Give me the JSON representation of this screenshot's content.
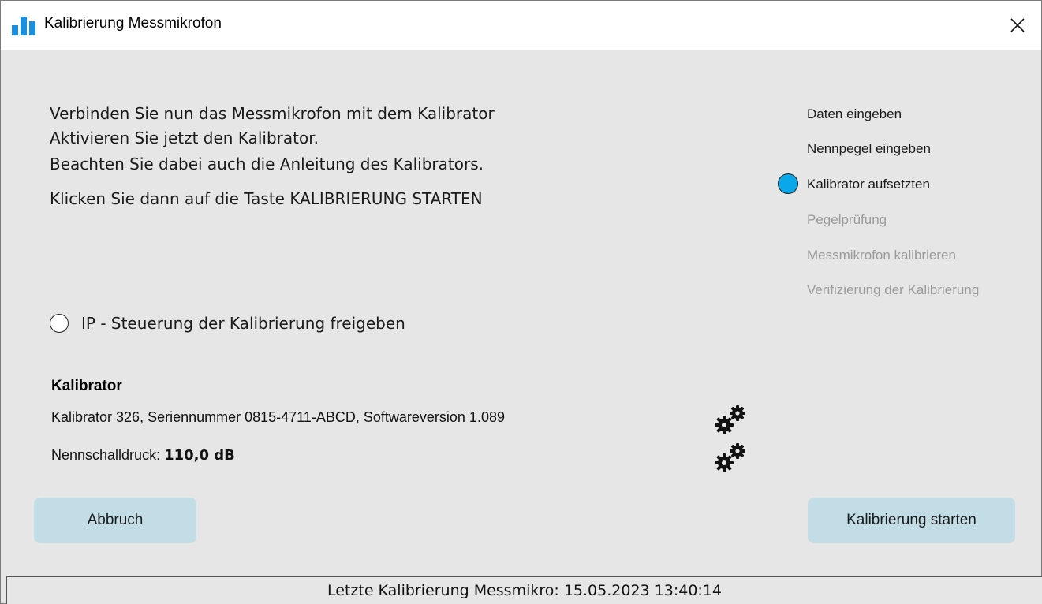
{
  "window": {
    "title": "Kalibrierung Messmikrofon",
    "close_glyph": "✕",
    "accent_color": "#0aa8e8"
  },
  "instructions": {
    "line1": "Verbinden Sie nun das Messmikrofon mit dem Kalibrator",
    "line2": "Aktivieren Sie jetzt den Kalibrator.",
    "line3": "Beachten Sie dabei auch die Anleitung des Kalibrators.",
    "line4": "Klicken Sie dann auf die Taste KALIBRIERUNG STARTEN"
  },
  "steps": [
    {
      "label": "Daten eingeben",
      "state": "done"
    },
    {
      "label": "Nennpegel eingeben",
      "state": "done"
    },
    {
      "label": "Kalibrator aufsetzten",
      "state": "current"
    },
    {
      "label": "Pegelprüfung",
      "state": "pending"
    },
    {
      "label": "Messmikrofon kalibrieren",
      "state": "pending"
    },
    {
      "label": "Verifizierung der Kalibrierung",
      "state": "pending"
    }
  ],
  "ip_control": {
    "label": "IP - Steuerung der Kalibrierung freigeben",
    "checked": false
  },
  "calibrator": {
    "heading": "Kalibrator",
    "details": "Kalibrator 326, Seriennummer 0815-4711-ABCD, Softwareversion 1.089",
    "pressure_label": "Nennschalldruck:",
    "pressure_value": "110,0 dB"
  },
  "buttons": {
    "cancel": "Abbruch",
    "start": "Kalibrierung starten"
  },
  "status": {
    "text": "Letzte Kalibrierung Messmikro: 15.05.2023 13:40:14"
  },
  "icons": {
    "app": "bar-chart-icon",
    "settings": "gears-icon"
  }
}
